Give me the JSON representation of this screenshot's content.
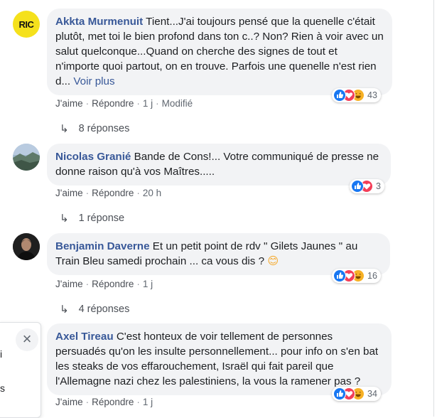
{
  "comments": [
    {
      "author": "Akkta Murmenuit",
      "avatar_text": "RIC",
      "text": "Tient...J'ai toujours pensé que la quenelle c'était plutôt, met toi le bien profond dans ton c..? Non? Rien à voir avec un salut quelconque...Quand on cherche des signes de tout et n'importe quoi partout, on en trouve. Parfois une quenelle n'est rien d...",
      "see_more": "Voir plus",
      "like": "J'aime",
      "reply": "Répondre",
      "time": "1 j",
      "edited": "Modifié",
      "reaction_count": "43",
      "reactions": [
        "like",
        "love",
        "haha"
      ],
      "replies": "8 réponses"
    },
    {
      "author": "Nicolas Granié",
      "text": "Bande de Cons!... Votre communiqué de presse ne donne raison qu'à vos Maîtres.....",
      "like": "J'aime",
      "reply": "Répondre",
      "time": "20 h",
      "reaction_count": "3",
      "reactions": [
        "like",
        "love"
      ],
      "replies": "1 réponse"
    },
    {
      "author": "Benjamin Daverne",
      "text": "Et un petit point de rdv \" Gilets Jaunes \" au Train Bleu samedi prochain ... ca vous dis ?",
      "emoji": "😊",
      "like": "J'aime",
      "reply": "Répondre",
      "time": "1 j",
      "reaction_count": "16",
      "reactions": [
        "like",
        "love",
        "haha"
      ],
      "replies": "4 réponses"
    },
    {
      "author": "Axel Tireau",
      "text": "C'est honteux de voir tellement de personnes persuadés qu'on les insulte personnellement... pour info on s'en bat les steaks de vos effarouchement, Israël qui fait pareil que l'Allemagne nazi chez les palestiniens, la vous la ramener pas ?",
      "like": "J'aime",
      "reply": "Répondre",
      "time": "1 j",
      "reaction_count": "34",
      "reactions": [
        "like",
        "love",
        "haha"
      ]
    }
  ],
  "side_panel": {
    "close": "×",
    "fragment_1": "i",
    "fragment_2": "s"
  },
  "colors": {
    "author": "#385898",
    "bubble": "#f2f3f5",
    "like": "#1877f2",
    "love": "#f33e58",
    "haha": "#f7b125",
    "ric_bg": "#f5e11c"
  }
}
